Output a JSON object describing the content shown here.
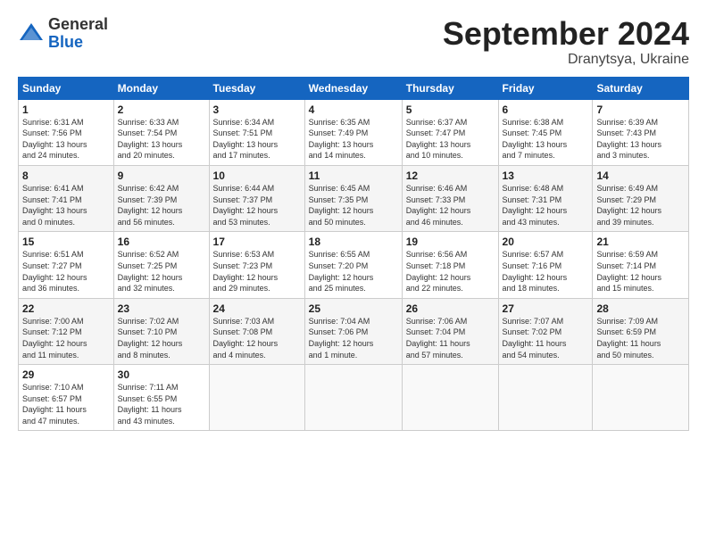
{
  "header": {
    "logo_general": "General",
    "logo_blue": "Blue",
    "month_title": "September 2024",
    "subtitle": "Dranytsya, Ukraine"
  },
  "days_of_week": [
    "Sunday",
    "Monday",
    "Tuesday",
    "Wednesday",
    "Thursday",
    "Friday",
    "Saturday"
  ],
  "weeks": [
    [
      {
        "day": "1",
        "info": "Sunrise: 6:31 AM\nSunset: 7:56 PM\nDaylight: 13 hours\nand 24 minutes."
      },
      {
        "day": "2",
        "info": "Sunrise: 6:33 AM\nSunset: 7:54 PM\nDaylight: 13 hours\nand 20 minutes."
      },
      {
        "day": "3",
        "info": "Sunrise: 6:34 AM\nSunset: 7:51 PM\nDaylight: 13 hours\nand 17 minutes."
      },
      {
        "day": "4",
        "info": "Sunrise: 6:35 AM\nSunset: 7:49 PM\nDaylight: 13 hours\nand 14 minutes."
      },
      {
        "day": "5",
        "info": "Sunrise: 6:37 AM\nSunset: 7:47 PM\nDaylight: 13 hours\nand 10 minutes."
      },
      {
        "day": "6",
        "info": "Sunrise: 6:38 AM\nSunset: 7:45 PM\nDaylight: 13 hours\nand 7 minutes."
      },
      {
        "day": "7",
        "info": "Sunrise: 6:39 AM\nSunset: 7:43 PM\nDaylight: 13 hours\nand 3 minutes."
      }
    ],
    [
      {
        "day": "8",
        "info": "Sunrise: 6:41 AM\nSunset: 7:41 PM\nDaylight: 13 hours\nand 0 minutes."
      },
      {
        "day": "9",
        "info": "Sunrise: 6:42 AM\nSunset: 7:39 PM\nDaylight: 12 hours\nand 56 minutes."
      },
      {
        "day": "10",
        "info": "Sunrise: 6:44 AM\nSunset: 7:37 PM\nDaylight: 12 hours\nand 53 minutes."
      },
      {
        "day": "11",
        "info": "Sunrise: 6:45 AM\nSunset: 7:35 PM\nDaylight: 12 hours\nand 50 minutes."
      },
      {
        "day": "12",
        "info": "Sunrise: 6:46 AM\nSunset: 7:33 PM\nDaylight: 12 hours\nand 46 minutes."
      },
      {
        "day": "13",
        "info": "Sunrise: 6:48 AM\nSunset: 7:31 PM\nDaylight: 12 hours\nand 43 minutes."
      },
      {
        "day": "14",
        "info": "Sunrise: 6:49 AM\nSunset: 7:29 PM\nDaylight: 12 hours\nand 39 minutes."
      }
    ],
    [
      {
        "day": "15",
        "info": "Sunrise: 6:51 AM\nSunset: 7:27 PM\nDaylight: 12 hours\nand 36 minutes."
      },
      {
        "day": "16",
        "info": "Sunrise: 6:52 AM\nSunset: 7:25 PM\nDaylight: 12 hours\nand 32 minutes."
      },
      {
        "day": "17",
        "info": "Sunrise: 6:53 AM\nSunset: 7:23 PM\nDaylight: 12 hours\nand 29 minutes."
      },
      {
        "day": "18",
        "info": "Sunrise: 6:55 AM\nSunset: 7:20 PM\nDaylight: 12 hours\nand 25 minutes."
      },
      {
        "day": "19",
        "info": "Sunrise: 6:56 AM\nSunset: 7:18 PM\nDaylight: 12 hours\nand 22 minutes."
      },
      {
        "day": "20",
        "info": "Sunrise: 6:57 AM\nSunset: 7:16 PM\nDaylight: 12 hours\nand 18 minutes."
      },
      {
        "day": "21",
        "info": "Sunrise: 6:59 AM\nSunset: 7:14 PM\nDaylight: 12 hours\nand 15 minutes."
      }
    ],
    [
      {
        "day": "22",
        "info": "Sunrise: 7:00 AM\nSunset: 7:12 PM\nDaylight: 12 hours\nand 11 minutes."
      },
      {
        "day": "23",
        "info": "Sunrise: 7:02 AM\nSunset: 7:10 PM\nDaylight: 12 hours\nand 8 minutes."
      },
      {
        "day": "24",
        "info": "Sunrise: 7:03 AM\nSunset: 7:08 PM\nDaylight: 12 hours\nand 4 minutes."
      },
      {
        "day": "25",
        "info": "Sunrise: 7:04 AM\nSunset: 7:06 PM\nDaylight: 12 hours\nand 1 minute."
      },
      {
        "day": "26",
        "info": "Sunrise: 7:06 AM\nSunset: 7:04 PM\nDaylight: 11 hours\nand 57 minutes."
      },
      {
        "day": "27",
        "info": "Sunrise: 7:07 AM\nSunset: 7:02 PM\nDaylight: 11 hours\nand 54 minutes."
      },
      {
        "day": "28",
        "info": "Sunrise: 7:09 AM\nSunset: 6:59 PM\nDaylight: 11 hours\nand 50 minutes."
      }
    ],
    [
      {
        "day": "29",
        "info": "Sunrise: 7:10 AM\nSunset: 6:57 PM\nDaylight: 11 hours\nand 47 minutes."
      },
      {
        "day": "30",
        "info": "Sunrise: 7:11 AM\nSunset: 6:55 PM\nDaylight: 11 hours\nand 43 minutes."
      },
      {
        "day": "",
        "info": ""
      },
      {
        "day": "",
        "info": ""
      },
      {
        "day": "",
        "info": ""
      },
      {
        "day": "",
        "info": ""
      },
      {
        "day": "",
        "info": ""
      }
    ]
  ]
}
